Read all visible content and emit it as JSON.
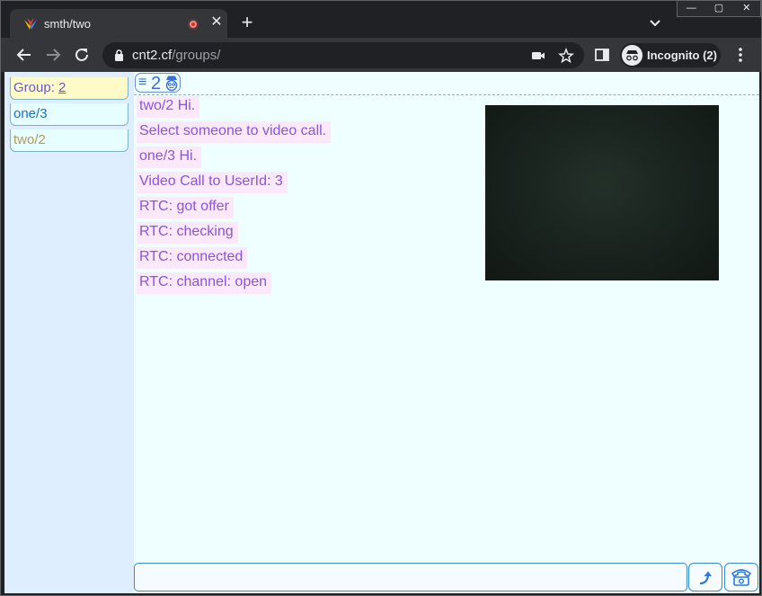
{
  "browser": {
    "tab_title": "smth/two",
    "url_host": "cnt2.cf",
    "url_path": "/groups/",
    "incognito_label": "Incognito (2)",
    "new_tab_symbol": "+",
    "tab_close_symbol": "✕",
    "win_minimize": "—",
    "win_maximize": "▢",
    "win_close": "✕"
  },
  "sidebar": {
    "group_label": "Group: ",
    "group_number": "2",
    "items": [
      {
        "label": "one/3"
      },
      {
        "label": "two/2"
      }
    ]
  },
  "header": {
    "menu_symbol": "≡",
    "count": "2"
  },
  "messages": [
    "two/2 Hi.",
    "Select someone to video call.",
    "one/3 Hi.",
    "Video Call to UserId: 3",
    "RTC: got offer",
    "RTC: checking",
    "RTC: connected",
    "RTC: channel: open"
  ],
  "composer": {
    "value": "",
    "placeholder": ""
  },
  "colors": {
    "page_bg": "#effefe",
    "sidebar_bg": "#dfeeff",
    "message_text": "#8a55d8",
    "message_bg": "#fbe9fb",
    "accent": "#3b8bc8"
  },
  "icons": {
    "tab_favicon": "colorful-v-logo-icon",
    "recording": "record-indicator-icon",
    "back": "arrow-left-icon",
    "forward": "arrow-right-icon",
    "reload": "reload-icon",
    "lock": "lock-icon",
    "camera": "video-camera-icon",
    "bookmark": "star-icon",
    "side_panel": "side-panel-icon",
    "incognito": "incognito-icon",
    "menu": "three-dots-icon",
    "send": "send-arrow-icon",
    "call": "telephone-icon"
  }
}
